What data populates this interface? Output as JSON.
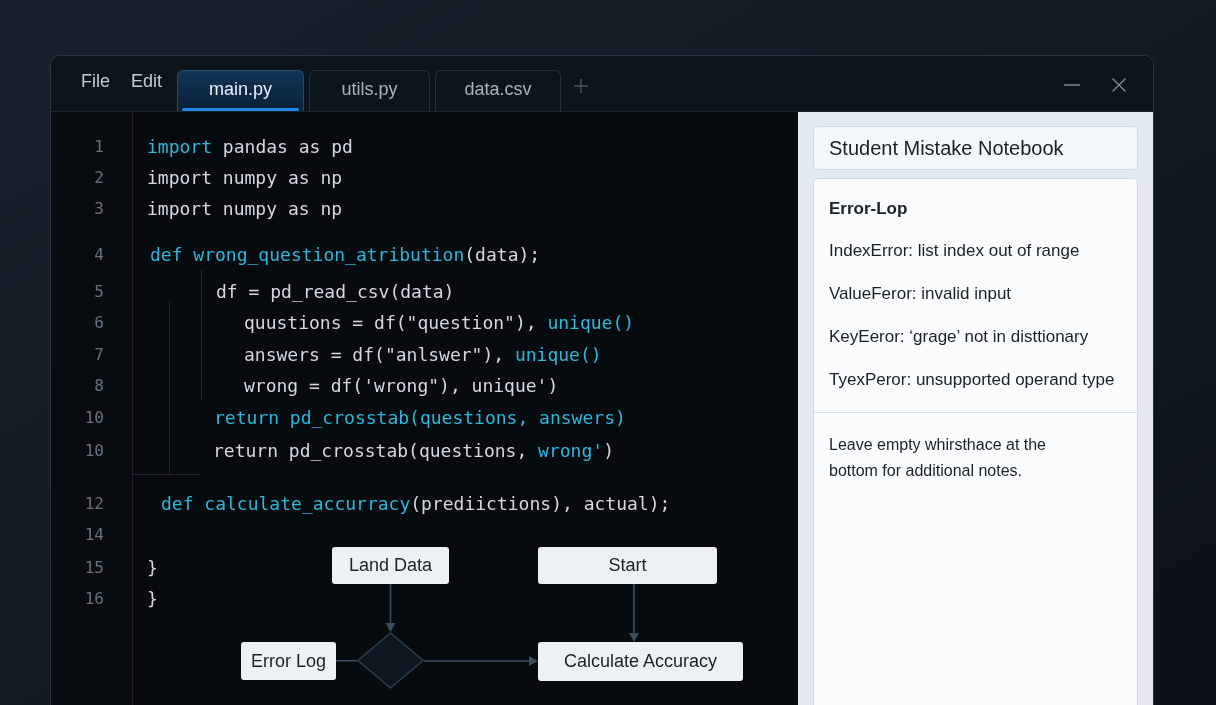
{
  "menu": [
    "File",
    "Edit"
  ],
  "tabs": [
    {
      "label": "main.py",
      "selected": true
    },
    {
      "label": "utils.py",
      "selected": false
    },
    {
      "label": "data.csv",
      "selected": false
    }
  ],
  "code": {
    "lines": [
      {
        "number": "1",
        "tokens": [
          {
            "text": "import",
            "kind": "keyword"
          },
          {
            "text": " pandas as pd",
            "kind": "plain"
          }
        ]
      },
      {
        "number": "2",
        "tokens": [
          {
            "text": "import numpy as np",
            "kind": "plain"
          }
        ]
      },
      {
        "number": "3",
        "tokens": [
          {
            "text": "import numpy as np",
            "kind": "plain"
          }
        ]
      },
      {
        "number": "4",
        "tokens": [
          {
            "text": "def wrong_question_atribution",
            "kind": "keyword"
          },
          {
            "text": "(data);",
            "kind": "plain"
          }
        ]
      },
      {
        "number": "5",
        "tokens": [
          {
            "text": "df = pd_read_csv(data)",
            "kind": "plain"
          }
        ]
      },
      {
        "number": "6",
        "tokens": [
          {
            "text": "quustions = df(\"question\"), ",
            "kind": "plain"
          },
          {
            "text": "unique()",
            "kind": "keyword"
          }
        ]
      },
      {
        "number": "7",
        "tokens": [
          {
            "text": "answers = df(\"anlswer\"), ",
            "kind": "plain"
          },
          {
            "text": "unique()",
            "kind": "keyword"
          }
        ]
      },
      {
        "number": "8",
        "tokens": [
          {
            "text": "wrong = df('wrong\"), unique')",
            "kind": "plain"
          }
        ]
      },
      {
        "number": "10",
        "tokens": [
          {
            "text": "return pd_crosstab(questions, answers)",
            "kind": "keyword"
          }
        ]
      },
      {
        "number": "10",
        "tokens": [
          {
            "text": "return pd_crosstab(questions, ",
            "kind": "plain"
          },
          {
            "text": "wrong'",
            "kind": "keyword"
          },
          {
            "text": ")",
            "kind": "plain"
          }
        ]
      },
      {
        "number": "12",
        "tokens": [
          {
            "text": "def calculate_accurracy",
            "kind": "keyword"
          },
          {
            "text": "(prediictions), actual);",
            "kind": "plain"
          }
        ]
      },
      {
        "number": "14"
      },
      {
        "number": "15",
        "tokens": [
          {
            "text": "}",
            "kind": "plain"
          }
        ]
      },
      {
        "number": "16",
        "tokens": [
          {
            "text": "}",
            "kind": "plain"
          }
        ]
      }
    ]
  },
  "flowchart": {
    "nodes": [
      {
        "kind": "box",
        "label": "Land Data"
      },
      {
        "kind": "box",
        "label": "Start"
      },
      {
        "kind": "box",
        "label": "Error Log"
      },
      {
        "kind": "decision"
      },
      {
        "kind": "box",
        "label": "Calculate Accuracy"
      }
    ]
  },
  "notebook": {
    "title": "Student Mistake Notebook",
    "section_title": "Error-Lop",
    "errors": [
      "IndexError: list index out of range",
      "ValueFeror: invalid input",
      "KeyEeror: ‘grage’ not in disttionary",
      "TyexPeror: unsupported operand type"
    ],
    "note": "Leave empty whirsthace at the bottom for additional notes."
  }
}
